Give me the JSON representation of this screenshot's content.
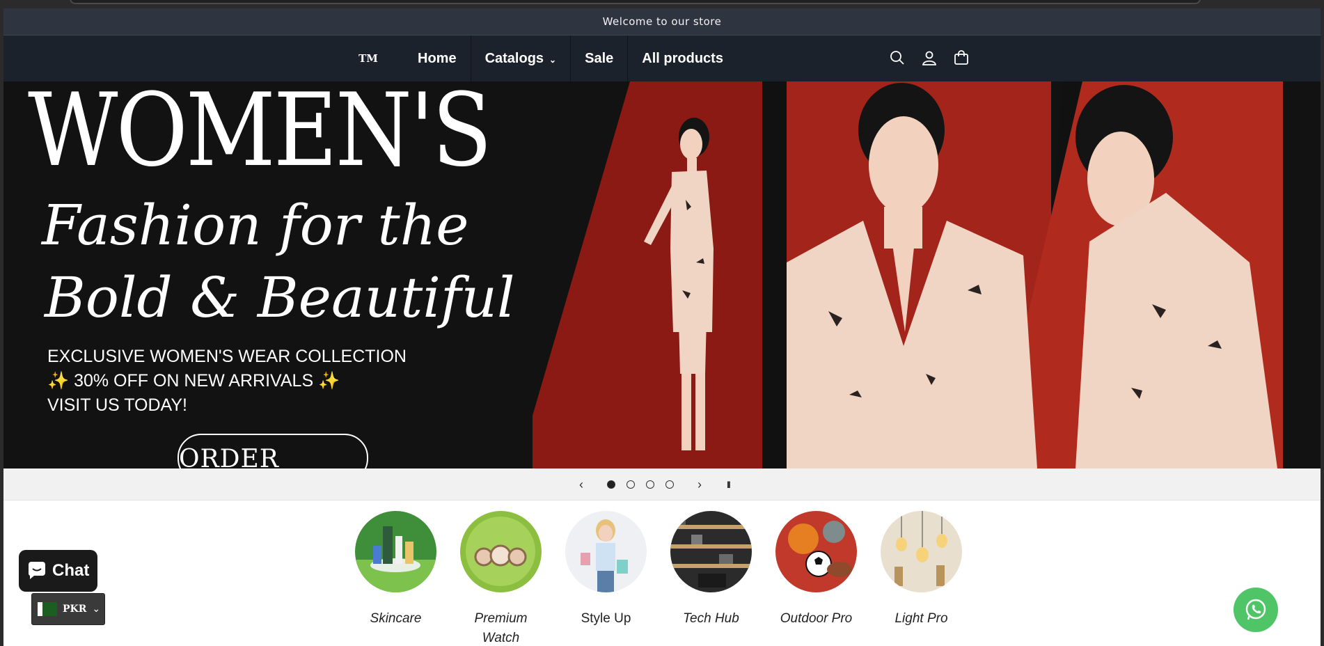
{
  "announcement": {
    "text": "Welcome to our store"
  },
  "header": {
    "logo_text": "TM",
    "nav": [
      {
        "label": "Home"
      },
      {
        "label": "Catalogs"
      },
      {
        "label": "Sale"
      },
      {
        "label": "All products"
      }
    ],
    "icons": [
      "search-icon",
      "account-icon",
      "cart-icon"
    ]
  },
  "hero": {
    "title": "WOMEN'S",
    "script_line1": "Fashion for the",
    "script_line2": "Bold & Beautiful",
    "info_line1": "EXCLUSIVE WOMEN'S WEAR COLLECTION",
    "info_line2": "✨ 30% OFF ON NEW ARRIVALS ✨",
    "info_line3": "VISIT US TODAY!",
    "cta": "ORDER NOW!",
    "colors": {
      "background": "#121212",
      "red": "#a3241a",
      "suit": "#f0d4c4"
    }
  },
  "slideshow": {
    "prev": "‹",
    "next": "›",
    "pause": "II",
    "slides": 4,
    "active": 1
  },
  "categories": [
    {
      "label": "Skincare"
    },
    {
      "label": "Premium Watch"
    },
    {
      "label": "Style Up"
    },
    {
      "label": "Tech Hub"
    },
    {
      "label": "Outdoor Pro"
    },
    {
      "label": "Light Pro"
    }
  ],
  "chat": {
    "label": "Chat"
  },
  "currency": {
    "code": "PKR"
  },
  "colors": {
    "header_bg": "#1c222b",
    "announcement_bg": "#2e3440",
    "whatsapp": "#4fc568"
  }
}
